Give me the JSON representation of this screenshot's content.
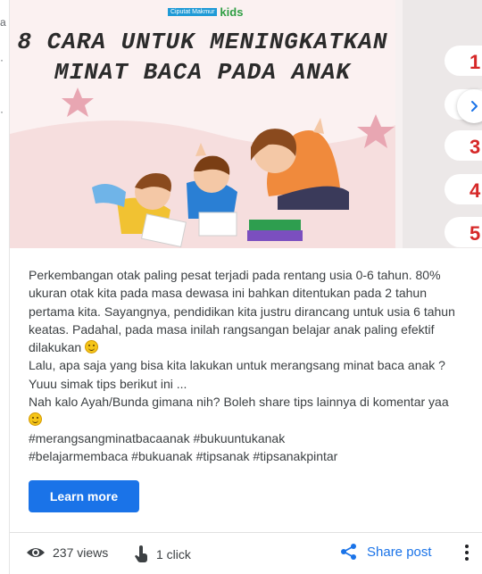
{
  "post": {
    "brand": {
      "org": "Ciputat Makmur",
      "kids": "kids"
    },
    "headline_line1": "8 CARA UNTUK MENINGKATKAN",
    "headline_line2": "MINAT BACA PADA ANAK",
    "next_slide_numbers": [
      "1",
      "2",
      "3",
      "4",
      "5"
    ],
    "paragraphs": [
      "Perkembangan otak paling pesat terjadi pada rentang usia 0-6 tahun. 80% ukuran otak kita pada masa dewasa ini bahkan ditentukan pada 2 tahun pertama kita. Sayangnya, pendidikan kita justru dirancang untuk usia 6 tahun keatas. Padahal, pada masa inilah rangsangan belajar anak paling efektif dilakukan",
      "Lalu, apa saja yang bisa kita lakukan untuk merangsang minat baca anak ? Yuuu simak tips berikut ini ...",
      "Nah kalo Ayah/Bunda gimana nih? Boleh share tips lainnya di komentar yaa",
      "#merangsangminatbacaanak #bukuuntukanak",
      "#belajarmembaca #bukuanak #tipsanak #tipsanakpintar"
    ],
    "learn_more": "Learn more"
  },
  "footer": {
    "views": "237 views",
    "clicks": "1 click",
    "share": "Share post"
  },
  "colors": {
    "accent": "#1a73e8",
    "slide_number": "#d62828",
    "slide_bg": "#f9eeee"
  },
  "icons": [
    "eye-icon",
    "touch-icon",
    "share-icon",
    "more-vert-icon",
    "chevron-right-icon",
    "smile-emoji-icon"
  ]
}
